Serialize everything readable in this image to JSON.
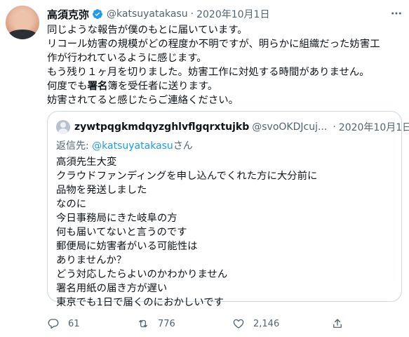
{
  "tweet": {
    "author_name": "高須克弥",
    "author_handle": "@katsuyatakasu",
    "separator": "·",
    "date": "2020年10月1日",
    "lines": [
      "同じような報告が僕のもとに届いています。",
      "リコール妨害の規模がどの程度か不明ですが、明らかに組織だった妨害工",
      "作が行われているように感じます。",
      "もう残り１ヶ月を切りました。妨害工作に対処する時間がありません。",
      "何度でも署名簿を受任者に送ります。",
      "妨害されてると感じたらご連絡ください。"
    ],
    "line4_parts": {
      "before": "何度でも",
      "bold": "署名",
      "after": "簿を受任者に送ります。"
    }
  },
  "quote": {
    "author_name": "zywtpqgkmdqyzghlvflgqrxtujkb",
    "author_handle": "@svoOKDJcuj...",
    "separator": "·",
    "date": "2020年10月1日",
    "reply_prefix": "返信先: ",
    "reply_mention": "@katsuyatakasu",
    "reply_suffix": "さん",
    "lines": [
      "高須先生大変",
      "クラウドファンディングを申し込んでくれた方に大分前に",
      "品物を発送しました",
      "なのに",
      "今日事務局にきた岐阜の方",
      "何も届いてないと言うのです",
      "郵便局に妨害者がいる可能性は",
      "ありませんか？",
      "どう対応したらよいのかわかりません",
      "署名用紙の届き方が遅い",
      "東京でも1日で届くのにおかしいです"
    ]
  },
  "actions": {
    "reply_count": "61",
    "retweet_count": "776",
    "like_count": "2,146"
  },
  "colors": {
    "accent": "#1d9bf0",
    "secondary_text": "#536471",
    "border": "#cfd9de"
  },
  "icons": [
    "verified-badge-icon",
    "more-icon",
    "reply-icon",
    "retweet-icon",
    "like-icon",
    "share-icon"
  ]
}
